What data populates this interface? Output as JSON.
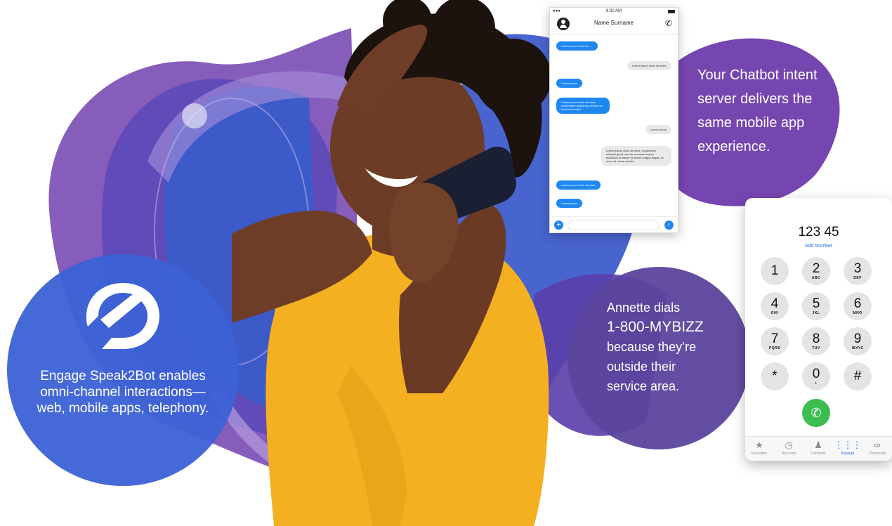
{
  "colors": {
    "purple_main": "#6a3fa6",
    "purple_light": "#8b6cc6",
    "blue_main": "#3557c8",
    "blue_circle": "#3a62d4",
    "dark_purple_circle": "#5b3f9b",
    "chat_blue": "#1e88f0",
    "call_green": "#3cbd4f"
  },
  "left_circle": {
    "logo": "speak2bot-logo",
    "text": "Engage Speak2Bot enables omni-channel interactions—web, mobile apps, telephony."
  },
  "right_top_text": "Your Chatbot intent server delivers the same mobile app experience.",
  "middle_circle": {
    "line1": "Annette dials",
    "line2": "1-800-MYBIZZ",
    "line3": "because they’re",
    "line4": "outside their",
    "line5": "service area."
  },
  "chat_phone": {
    "time": "8:30 AM",
    "contact_name": "Name Surname",
    "messages": [
      {
        "dir": "in",
        "text": "Lorem ipsum dolor sit......"
      },
      {
        "dir": "out",
        "text": "Lorem ipsum dolor sit amet."
      },
      {
        "dir": "in",
        "text": "Lorem ipsum"
      },
      {
        "dir": "in",
        "text": "Lorem ipsum dolor sit amet, consectetur adipiscing elit sed do eiusmod tempor"
      },
      {
        "dir": "out",
        "text": "Lorem ipsum"
      },
      {
        "dir": "out",
        "text": "Lorem ipsum dolor sit amet, consectetur adipiscing elit, sed do eiusmod tempor incididunt ut labore et dolore magna aliqua. Ut enim ad minim veniam"
      },
      {
        "dir": "in",
        "text": "Lorem ipsum dolor sit amet."
      },
      {
        "dir": "in",
        "text": "Lorem ipsum"
      }
    ]
  },
  "keypad_phone": {
    "number": "123 45",
    "add_number": "Add Number",
    "keys": [
      {
        "digit": "1",
        "letters": ""
      },
      {
        "digit": "2",
        "letters": "ABC"
      },
      {
        "digit": "3",
        "letters": "DEF"
      },
      {
        "digit": "4",
        "letters": "GHI"
      },
      {
        "digit": "5",
        "letters": "JKL"
      },
      {
        "digit": "6",
        "letters": "MNO"
      },
      {
        "digit": "7",
        "letters": "PQRS"
      },
      {
        "digit": "8",
        "letters": "TUV"
      },
      {
        "digit": "9",
        "letters": "WXYZ"
      },
      {
        "digit": "*",
        "letters": ""
      },
      {
        "digit": "0",
        "letters": "+"
      },
      {
        "digit": "#",
        "letters": ""
      }
    ],
    "tabs": [
      {
        "label": "Favorites",
        "icon": "star-icon"
      },
      {
        "label": "Recents",
        "icon": "clock-icon"
      },
      {
        "label": "Contacts",
        "icon": "contacts-icon"
      },
      {
        "label": "Keypad",
        "icon": "keypad-icon",
        "active": true
      },
      {
        "label": "Voicemail",
        "icon": "voicemail-icon"
      }
    ]
  }
}
